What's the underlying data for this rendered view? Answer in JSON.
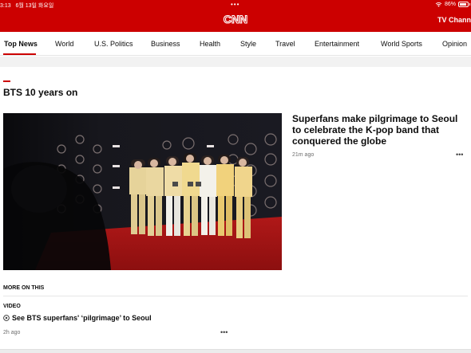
{
  "status_bar": {
    "time": "3:13",
    "date": "6월 13일 화요일",
    "battery": "86%"
  },
  "header": {
    "logo_text": "CNN",
    "tv_channels": "TV Channe"
  },
  "nav": {
    "items": [
      "Top News",
      "World",
      "U.S. Politics",
      "Business",
      "Health",
      "Style",
      "Travel",
      "Entertainment",
      "World Sports",
      "Opinion"
    ],
    "active": "Top News"
  },
  "section": {
    "title": "BTS 10 years on"
  },
  "lead_story": {
    "headline": "Superfans make pilgrimage to Seoul to celebrate the K-pop band that conquered the globe",
    "timestamp": "21m ago"
  },
  "more_on_this": {
    "label": "MORE ON THIS",
    "video_label": "VIDEO",
    "video_headline": "See BTS superfans' ‘pilgrimage’ to Seoul",
    "timestamp": "2h ago"
  },
  "icons": {
    "more": "more-horizontal-icon",
    "play": "play-circle-icon",
    "wifi": "wifi-icon",
    "battery": "battery-icon"
  },
  "colors": {
    "brand_red": "#cc0000",
    "text": "#0c0c0c",
    "muted": "#6e6e6e"
  }
}
